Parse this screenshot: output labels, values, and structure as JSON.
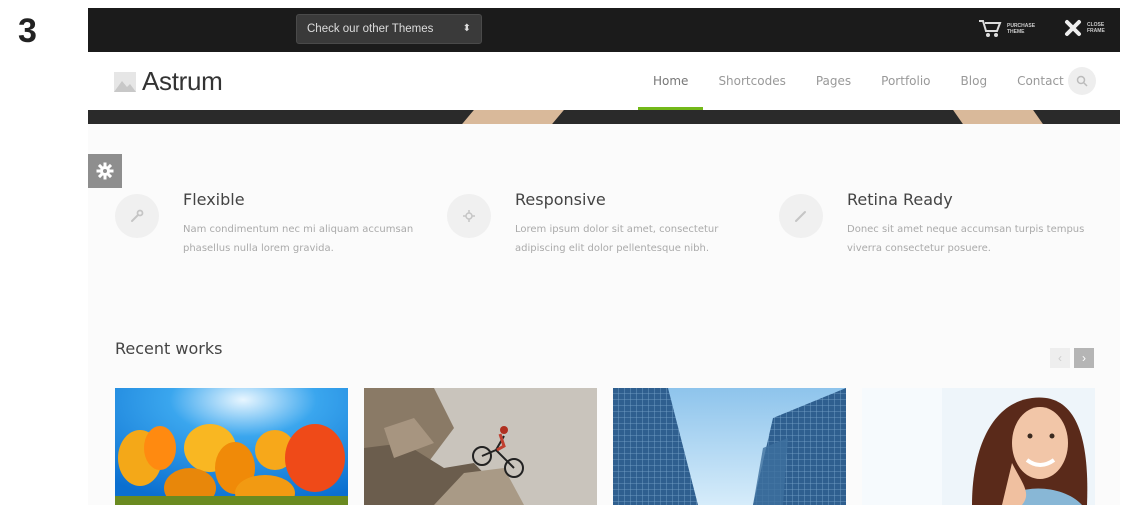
{
  "step_number": "3",
  "demo_bar": {
    "theme_select_value": "Check our other Themes",
    "purchase_label": "Purchase Theme",
    "close_label": "Close Frame"
  },
  "header": {
    "logo_text": "Astrum",
    "nav": [
      "Home",
      "Shortcodes",
      "Pages",
      "Portfolio",
      "Blog",
      "Contact"
    ],
    "active_nav": "Home"
  },
  "features": [
    {
      "title": "Flexible",
      "text": "Nam condimentum nec mi aliquam accumsan phasellus nulla lorem gravida.",
      "icon": "wrench-icon"
    },
    {
      "title": "Responsive",
      "text": "Lorem ipsum dolor sit amet, consectetur adipiscing elit dolor pellentesque nibh.",
      "icon": "crosshair-icon"
    },
    {
      "title": "Retina Ready",
      "text": "Donec sit amet neque accumsan turpis tempus viverra consectetur posuere.",
      "icon": "pen-icon"
    }
  ],
  "recent_works": {
    "title": "Recent works",
    "items": [
      "flowers-image",
      "mountain-biker-image",
      "skyscrapers-image",
      "smiling-woman-image"
    ]
  },
  "colors": {
    "accent": "#73b819",
    "topbar": "#1b1b1b"
  }
}
